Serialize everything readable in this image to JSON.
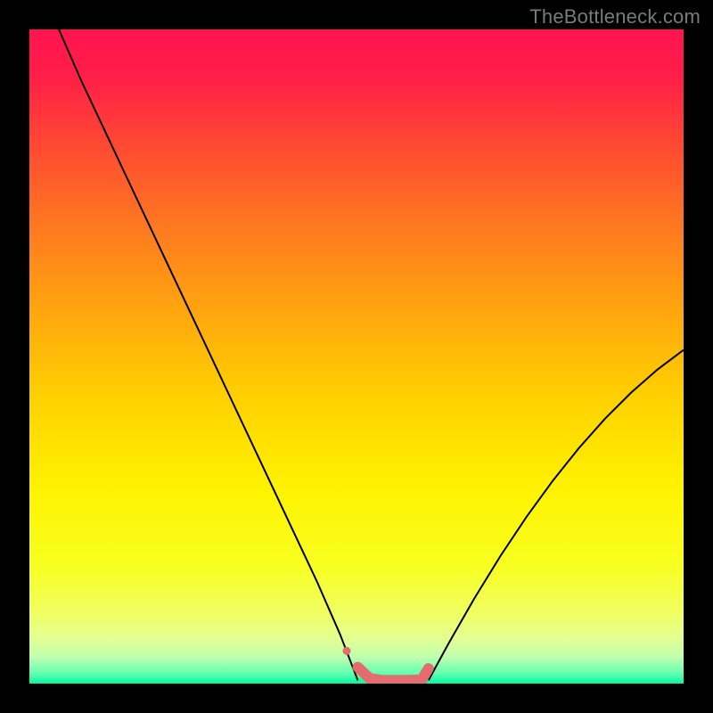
{
  "watermark": "TheBottleneck.com",
  "chart_data": {
    "type": "line",
    "title": "",
    "xlabel": "",
    "ylabel": "",
    "xlim": [
      0,
      100
    ],
    "ylim": [
      0,
      100
    ],
    "grid": false,
    "legend": false,
    "gradient_stops": [
      {
        "pos": 0.0,
        "color": "#ff1450"
      },
      {
        "pos": 0.07,
        "color": "#ff1e48"
      },
      {
        "pos": 0.18,
        "color": "#ff4a32"
      },
      {
        "pos": 0.3,
        "color": "#ff7820"
      },
      {
        "pos": 0.42,
        "color": "#ffa210"
      },
      {
        "pos": 0.56,
        "color": "#ffd000"
      },
      {
        "pos": 0.7,
        "color": "#fff200"
      },
      {
        "pos": 0.82,
        "color": "#f8ff20"
      },
      {
        "pos": 0.89,
        "color": "#f0ff60"
      },
      {
        "pos": 0.93,
        "color": "#e5ff90"
      },
      {
        "pos": 0.96,
        "color": "#bfffb0"
      },
      {
        "pos": 0.985,
        "color": "#60ffb0"
      },
      {
        "pos": 1.0,
        "color": "#00f8a0"
      }
    ],
    "series": [
      {
        "name": "left-curve",
        "color": "#000000",
        "width": 2,
        "x": [
          4.5,
          8,
          12,
          16,
          20,
          24,
          28,
          32,
          36,
          40,
          44,
          47.5,
          50.2
        ],
        "y": [
          100,
          92,
          83.5,
          75,
          66.5,
          58,
          49.5,
          41,
          32.5,
          24,
          15.5,
          7.5,
          0.5
        ]
      },
      {
        "name": "right-curve",
        "color": "#000000",
        "width": 2,
        "x": [
          61,
          64,
          68,
          72,
          76,
          80,
          84,
          88,
          92,
          96,
          100
        ],
        "y": [
          0.5,
          6,
          13,
          19.5,
          25.5,
          31,
          36,
          40.5,
          44.5,
          48,
          51
        ]
      },
      {
        "name": "bottom-segment",
        "color": "#e46c6c",
        "width": 12,
        "linecap": "round",
        "x": [
          50.2,
          52,
          54,
          56,
          58,
          60,
          61
        ],
        "y": [
          2.5,
          0.8,
          0.5,
          0.5,
          0.5,
          0.6,
          2.3
        ]
      },
      {
        "name": "bottom-dot",
        "color": "#e46c6c",
        "type": "scatter",
        "x": [
          48.5
        ],
        "y": [
          5.0
        ],
        "size": 9
      }
    ]
  }
}
